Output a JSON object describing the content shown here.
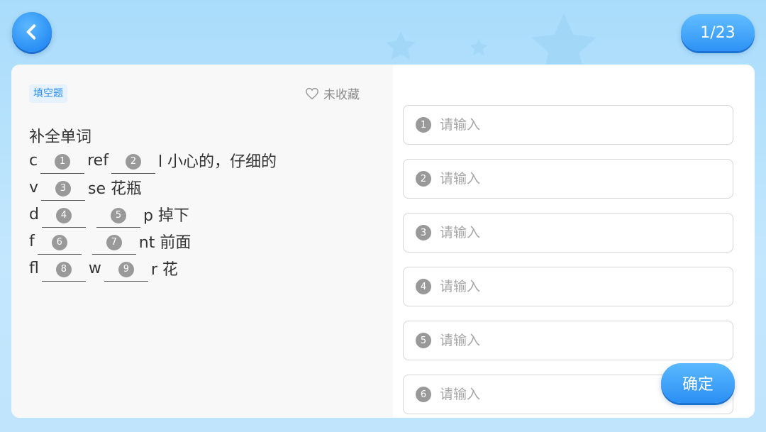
{
  "header": {
    "back_icon": "chevron-left-icon",
    "progress": "1/23"
  },
  "question": {
    "type_tag": "填空题",
    "favorite_label": "未收藏",
    "favorite_icon": "heart-outline-icon",
    "title": "补全单词",
    "lines": [
      {
        "parts": [
          {
            "t": "c"
          },
          {
            "b": "1"
          },
          {
            "t": "ref"
          },
          {
            "b": "2"
          },
          {
            "t": "l 小心的，仔细的"
          }
        ]
      },
      {
        "parts": [
          {
            "t": "v"
          },
          {
            "b": "3"
          },
          {
            "t": "se 花瓶"
          }
        ]
      },
      {
        "parts": [
          {
            "t": "d"
          },
          {
            "b": "4"
          },
          {
            "t": " "
          },
          {
            "b": "5"
          },
          {
            "t": "p 掉下"
          }
        ]
      },
      {
        "parts": [
          {
            "t": "f"
          },
          {
            "b": "6"
          },
          {
            "t": " "
          },
          {
            "b": "7"
          },
          {
            "t": "nt 前面"
          }
        ]
      },
      {
        "parts": [
          {
            "t": "fl"
          },
          {
            "b": "8"
          },
          {
            "t": "w"
          },
          {
            "b": "9"
          },
          {
            "t": "r 花"
          }
        ]
      }
    ]
  },
  "answers": {
    "placeholder": "请输入",
    "fields": [
      {
        "num": "1",
        "value": ""
      },
      {
        "num": "2",
        "value": ""
      },
      {
        "num": "3",
        "value": ""
      },
      {
        "num": "4",
        "value": ""
      },
      {
        "num": "5",
        "value": ""
      },
      {
        "num": "6",
        "value": ""
      }
    ]
  },
  "confirm_label": "确定",
  "colors": {
    "accent": "#2a8ff5",
    "badge": "#999999"
  }
}
